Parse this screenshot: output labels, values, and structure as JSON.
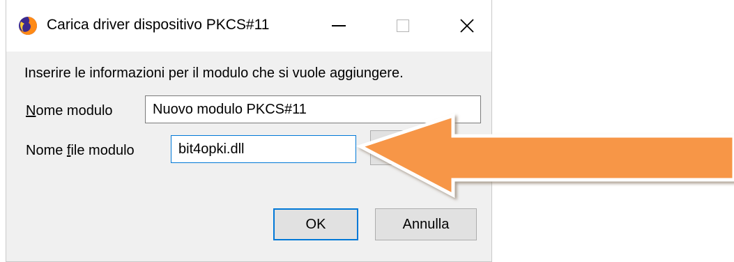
{
  "window": {
    "title": "Carica driver dispositivo PKCS#11",
    "icon": "firefox-icon",
    "controls": {
      "minimize": "minimize-icon",
      "maximize": "maximize-icon",
      "close": "close-icon"
    }
  },
  "form": {
    "intro": "Inserire le informazioni per il modulo che si vuole aggiungere.",
    "module_name": {
      "label_mnemonic": "N",
      "label_rest": "ome modulo",
      "value": "Nuovo modulo PKCS#11"
    },
    "module_file": {
      "label_before": "Nome ",
      "label_mnemonic": "f",
      "label_after": "ile modulo",
      "value": "bit4opki.dll"
    }
  },
  "buttons": {
    "ok_label": "OK",
    "cancel_label": "Annulla"
  },
  "annotation": {
    "arrow_color": "#f79646",
    "arrow_outline": "#ffffff"
  },
  "colors": {
    "accent": "#0078d7",
    "dialog_bg": "#f0f0f0",
    "button_bg": "#e1e1e1"
  }
}
